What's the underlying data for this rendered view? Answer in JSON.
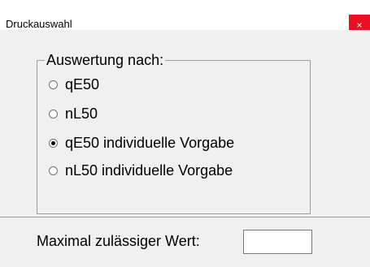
{
  "window": {
    "title": "Druckauswahl",
    "close_label": "×"
  },
  "group": {
    "legend": "Auswertung nach:",
    "options": [
      {
        "label": "qE50",
        "checked": false
      },
      {
        "label": "nL50",
        "checked": false
      },
      {
        "label": "qE50 individuelle Vorgabe",
        "checked": true
      },
      {
        "label": "nL50 individuelle Vorgabe",
        "checked": false
      }
    ]
  },
  "max_value": {
    "label": "Maximal zulässiger Wert:",
    "value": ""
  },
  "colors": {
    "close_button": "#e81123",
    "dialog_background": "#f0f0f0",
    "titlebar_background": "#ffffff"
  }
}
